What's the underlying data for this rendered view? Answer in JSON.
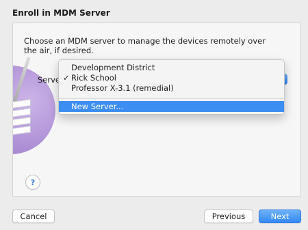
{
  "dialog": {
    "title": "Enroll in MDM Server",
    "instructions": "Choose an MDM server to manage the devices remotely over the air, if desired.",
    "server_label": "Server"
  },
  "menu": {
    "items": [
      {
        "label": "Development District",
        "checked": false
      },
      {
        "label": "Rick School",
        "checked": true
      },
      {
        "label": "Professor X-3.1 (remedial)",
        "checked": false
      },
      {
        "label": "New Server...",
        "highlighted": true
      }
    ],
    "check_glyph": "✓"
  },
  "help": {
    "glyph": "?"
  },
  "buttons": {
    "cancel": "Cancel",
    "previous": "Previous",
    "next": "Next"
  },
  "colors": {
    "accent": "#3d8ef2",
    "background": "#ececec"
  }
}
